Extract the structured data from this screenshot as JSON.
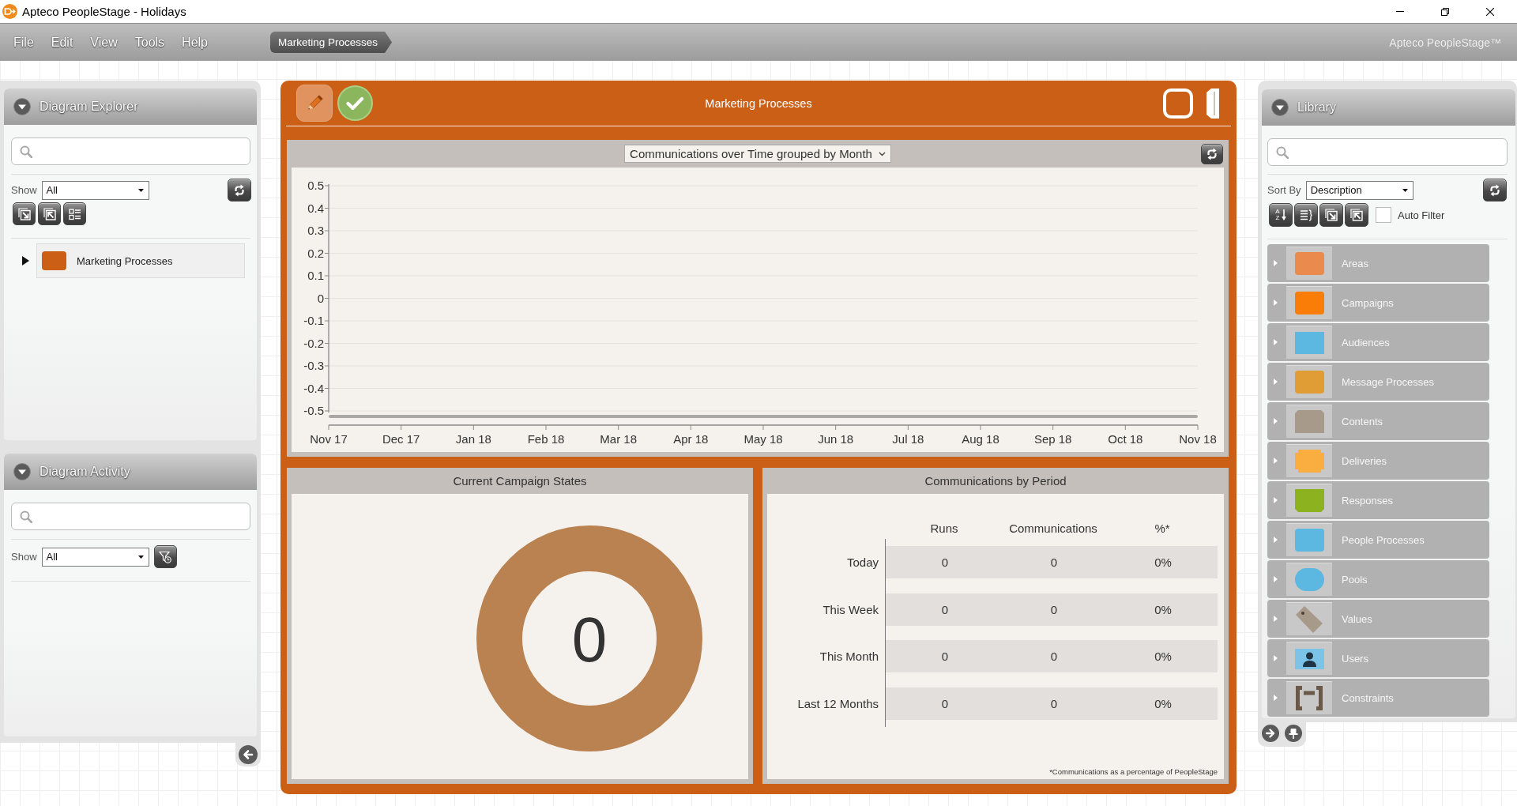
{
  "window": {
    "title": "Apteco PeopleStage - Holidays"
  },
  "menu": [
    {
      "label": "File"
    },
    {
      "label": "Edit"
    },
    {
      "label": "View"
    },
    {
      "label": "Tools"
    },
    {
      "label": "Help"
    }
  ],
  "breadcrumb": [
    {
      "label": "Marketing Processes"
    }
  ],
  "brand": "Apteco PeopleStage™",
  "diagram_explorer": {
    "title": "Diagram Explorer",
    "show_label": "Show",
    "show_value": "All",
    "tree": [
      {
        "label": "Marketing Processes",
        "color": "#cc5f16",
        "expanded": false
      }
    ]
  },
  "diagram_activity": {
    "title": "Diagram Activity",
    "show_label": "Show",
    "show_value": "All"
  },
  "diagram": {
    "title": "Marketing Processes",
    "chart": {
      "selector": "Communications over Time grouped by Month",
      "chart_data": {
        "type": "line",
        "categories": [
          "Nov 17",
          "Dec 17",
          "Jan 18",
          "Feb 18",
          "Mar 18",
          "Apr 18",
          "May 18",
          "Jun 18",
          "Jul 18",
          "Aug 18",
          "Sep 18",
          "Oct 18",
          "Nov 18"
        ],
        "ylim": [
          -0.5,
          0.5
        ],
        "yticks": [
          0.5,
          0.4,
          0.3,
          0.2,
          0.1,
          0,
          -0.1,
          -0.2,
          -0.3,
          -0.4,
          -0.5
        ],
        "grid": true
      }
    },
    "campaign_states": {
      "title": "Current Campaign States",
      "total": "0"
    },
    "period_table": {
      "title": "Communications by Period",
      "columns": [
        "Runs",
        "Communications",
        "%*"
      ],
      "rows": [
        {
          "period": "Today",
          "values": [
            "0",
            "0",
            "0%"
          ]
        },
        {
          "period": "This Week",
          "values": [
            "0",
            "0",
            "0%"
          ]
        },
        {
          "period": "This Month",
          "values": [
            "0",
            "0",
            "0%"
          ]
        },
        {
          "period": "Last 12 Months",
          "values": [
            "0",
            "0",
            "0%"
          ]
        }
      ],
      "footnote": "*Communications as a percentage of PeopleStage"
    }
  },
  "library": {
    "title": "Library",
    "sort_label": "Sort By",
    "sort_value": "Description",
    "sort_letters": [
      "A",
      "Z"
    ],
    "auto_filter": {
      "label": "Auto Filter",
      "checked": false
    },
    "items": [
      {
        "label": "Areas",
        "kind": "rounded",
        "color": "#ea8a4c",
        "expanded": false
      },
      {
        "label": "Campaigns",
        "kind": "rounded",
        "color": "#f97d06",
        "expanded": false
      },
      {
        "label": "Audiences",
        "kind": "square",
        "color": "#5cb8e0",
        "expanded": false
      },
      {
        "label": "Message Processes",
        "kind": "rounded",
        "color": "#e09d35",
        "expanded": false
      },
      {
        "label": "Contents",
        "kind": "clipped-top",
        "color": "#a89a8a",
        "expanded": false
      },
      {
        "label": "Deliveries",
        "kind": "notched",
        "color": "#f9ae3f",
        "expanded": false
      },
      {
        "label": "Responses",
        "kind": "clipped-bottom",
        "color": "#8db21f",
        "expanded": false
      },
      {
        "label": "People Processes",
        "kind": "rounded",
        "color": "#5cb8e0",
        "expanded": false
      },
      {
        "label": "Pools",
        "kind": "pill",
        "color": "#5cb8e0",
        "expanded": false
      },
      {
        "label": "Values",
        "kind": "tag",
        "color": "#a89a8a",
        "expanded": false
      },
      {
        "label": "Users",
        "kind": "person",
        "color": "#7cc3e8",
        "expanded": false
      },
      {
        "label": "Constraints",
        "kind": "bracket",
        "color": "#6a5848",
        "expanded": false
      }
    ]
  }
}
